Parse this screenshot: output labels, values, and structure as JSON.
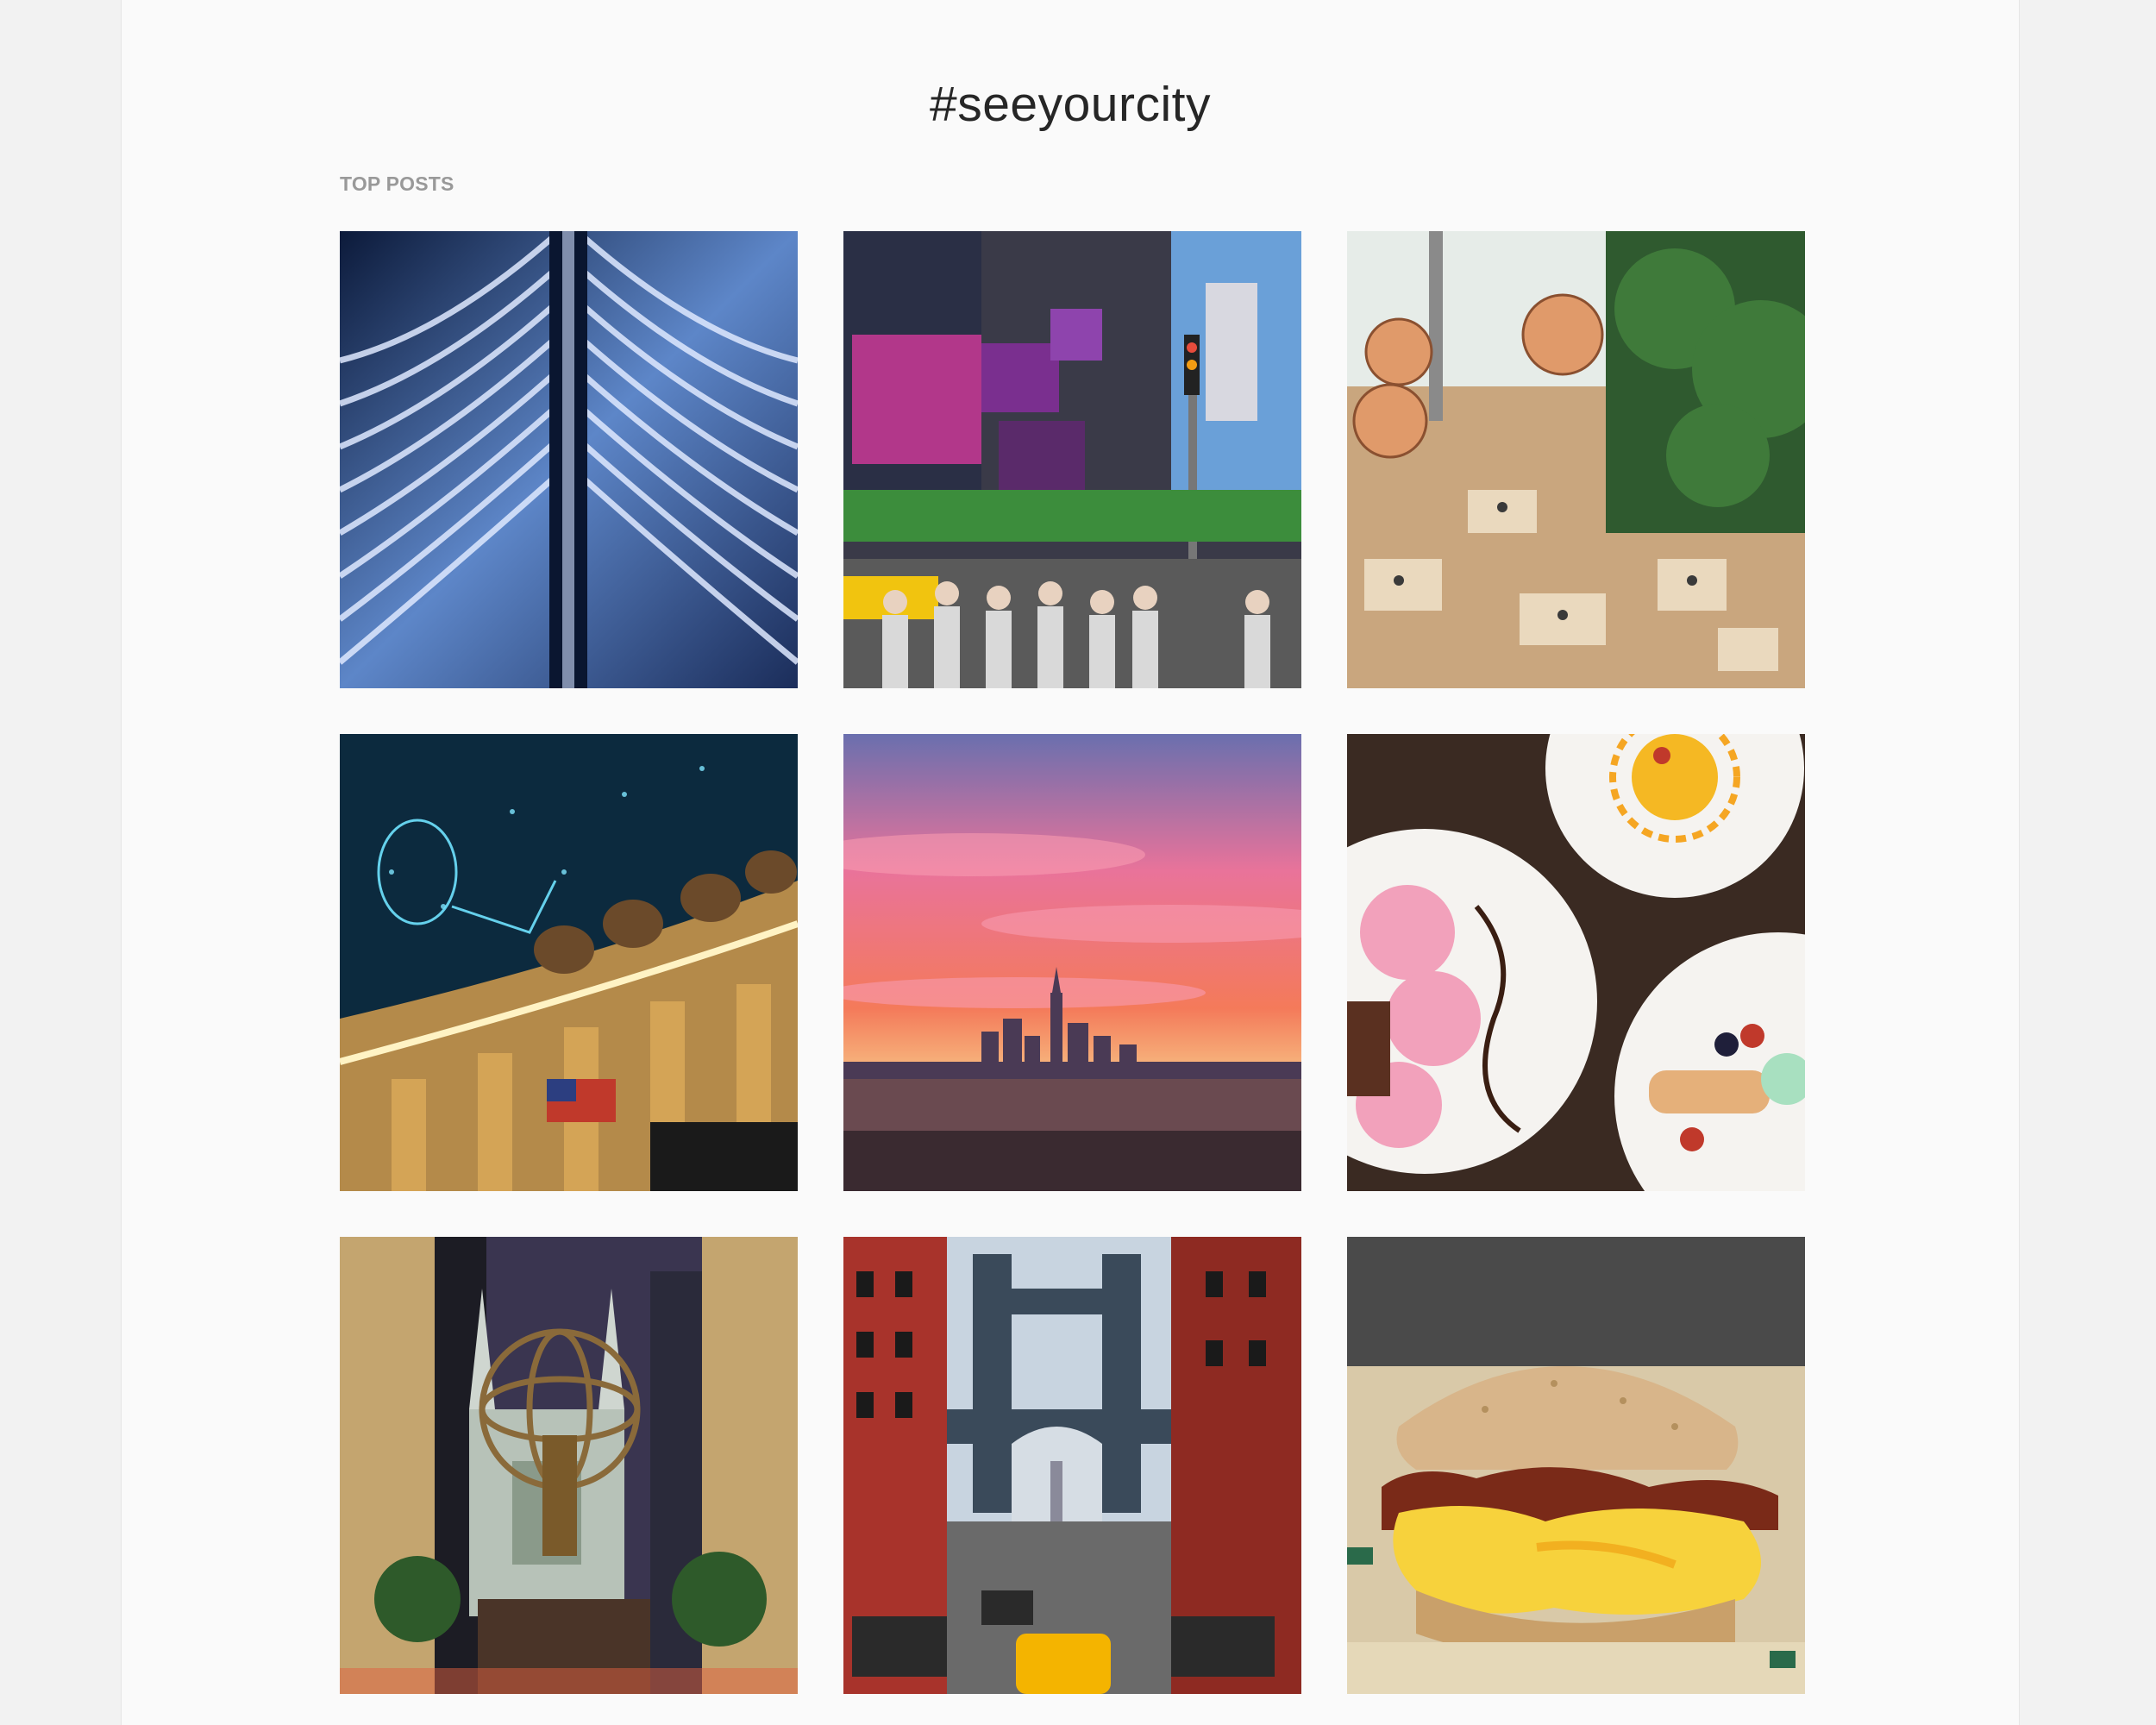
{
  "hashtag": "#seeyourcity",
  "section_label": "TOP POSTS",
  "posts": [
    {
      "icon": "oculus-ribs-photo"
    },
    {
      "icon": "times-square-photo"
    },
    {
      "icon": "restaurant-interior-photo"
    },
    {
      "icon": "grand-central-ceiling-photo"
    },
    {
      "icon": "sunset-skyline-photo"
    },
    {
      "icon": "desserts-plates-photo"
    },
    {
      "icon": "atlas-statue-cathedral-photo"
    },
    {
      "icon": "manhattan-bridge-photo"
    },
    {
      "icon": "breakfast-sandwich-photo"
    }
  ]
}
